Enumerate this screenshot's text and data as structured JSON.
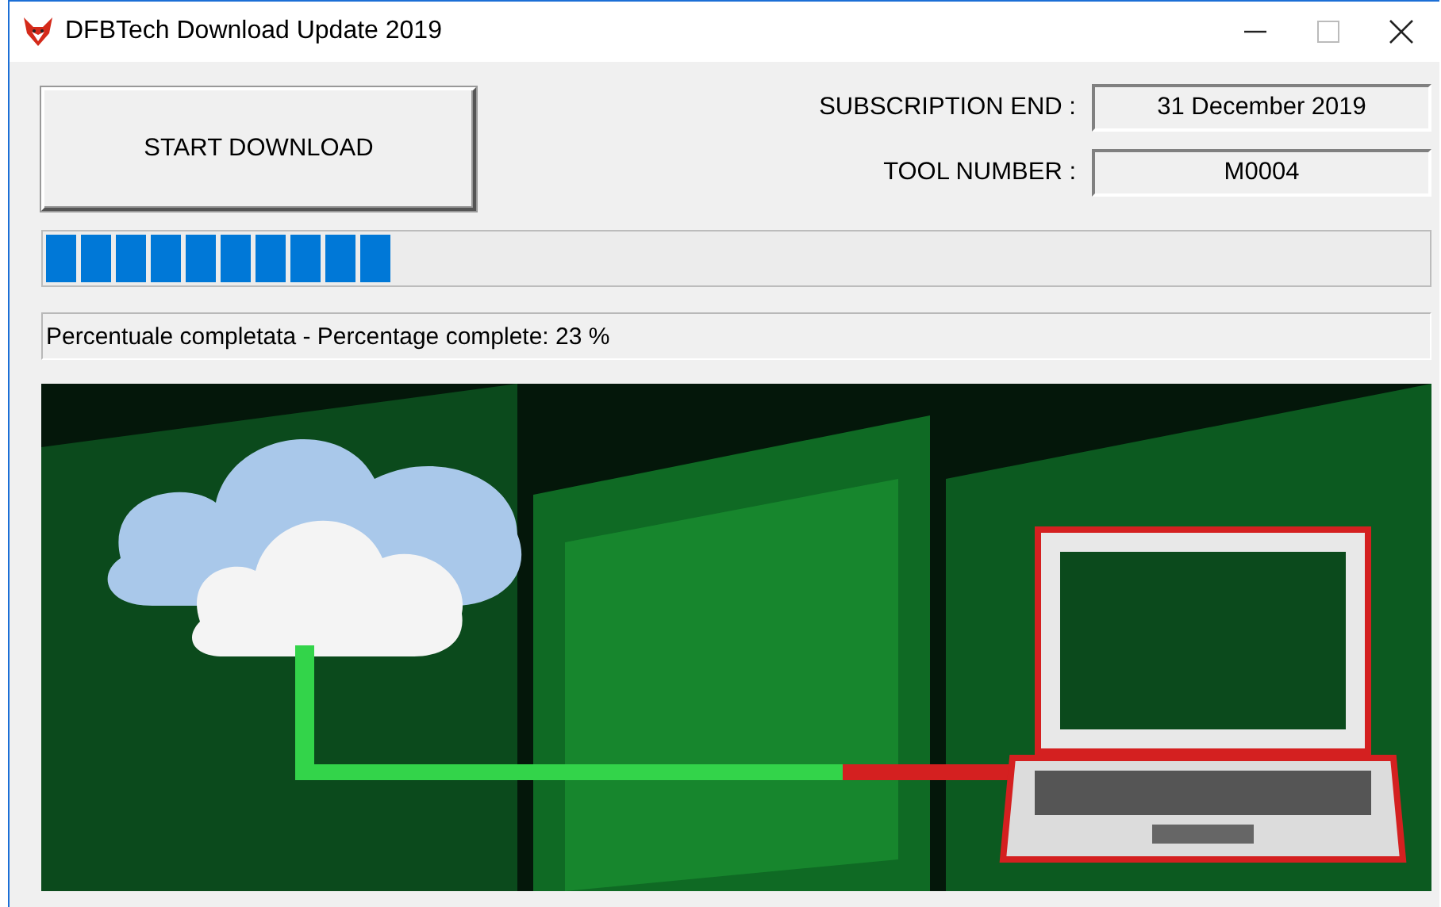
{
  "window": {
    "title": "DFBTech Download Update 2019"
  },
  "start_button": {
    "label": "START DOWNLOAD"
  },
  "fields": [
    {
      "label": "SUBSCRIPTION END :",
      "value": "31 December 2019"
    },
    {
      "label": "TOOL NUMBER :",
      "value": "M0004"
    }
  ],
  "progress": {
    "level": 0.25
  },
  "status": {
    "text": "Percentuale completata - Percentage complete: 23 %"
  }
}
